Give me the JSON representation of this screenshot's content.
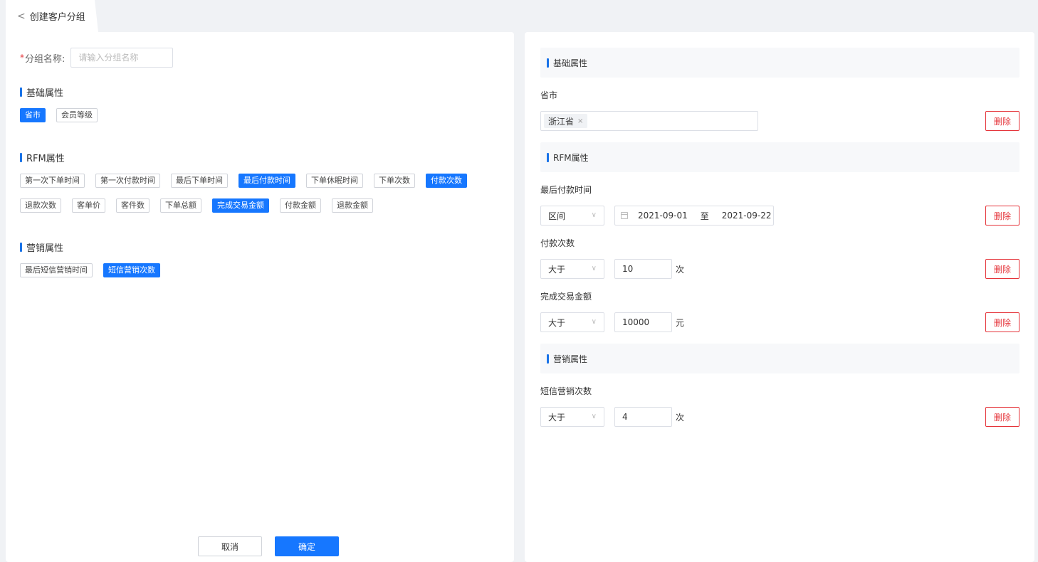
{
  "header": {
    "back_icon": "chevron-left-icon",
    "title": "创建客户分组"
  },
  "form": {
    "required_mark": "*",
    "name_label": "分组名称:",
    "name_placeholder": "请输入分组名称"
  },
  "attribute_groups": [
    {
      "title": "基础属性",
      "tags": [
        {
          "label": "省市",
          "selected": true
        },
        {
          "label": "会员等级",
          "selected": false
        }
      ]
    },
    {
      "title": "RFM属性",
      "tags": [
        {
          "label": "第一次下单时间",
          "selected": false
        },
        {
          "label": "第一次付款时间",
          "selected": false
        },
        {
          "label": "最后下单时间",
          "selected": false
        },
        {
          "label": "最后付款时间",
          "selected": true
        },
        {
          "label": "下单休眠时间",
          "selected": false
        },
        {
          "label": "下单次数",
          "selected": false
        },
        {
          "label": "付款次数",
          "selected": true
        },
        {
          "label": "退款次数",
          "selected": false
        },
        {
          "label": "客单价",
          "selected": false
        },
        {
          "label": "客件数",
          "selected": false
        },
        {
          "label": "下单总额",
          "selected": false
        },
        {
          "label": "完成交易金额",
          "selected": true
        },
        {
          "label": "付款金额",
          "selected": false
        },
        {
          "label": "退款金额",
          "selected": false
        }
      ]
    },
    {
      "title": "营销属性",
      "tags": [
        {
          "label": "最后短信营销时间",
          "selected": false
        },
        {
          "label": "短信营销次数",
          "selected": true
        }
      ]
    }
  ],
  "buttons": {
    "cancel": "取消",
    "confirm": "确定"
  },
  "conditions": {
    "basic": {
      "title": "基础属性",
      "province": {
        "label": "省市",
        "chip": "浙江省",
        "chip_close": "×"
      }
    },
    "rfm": {
      "title": "RFM属性",
      "last_payment_time": {
        "label": "最后付款时间",
        "operator": "区间",
        "start": "2021-09-01",
        "to": "至",
        "end": "2021-09-22"
      },
      "payment_count": {
        "label": "付款次数",
        "operator": "大于",
        "value": "10",
        "unit": "次"
      },
      "completed_amount": {
        "label": "完成交易金额",
        "operator": "大于",
        "value": "10000",
        "unit": "元"
      }
    },
    "marketing": {
      "title": "营销属性",
      "sms_count": {
        "label": "短信营销次数",
        "operator": "大于",
        "value": "4",
        "unit": "次"
      }
    },
    "delete_label": "删除",
    "dropdown_arrow": "∨"
  },
  "colors": {
    "primary": "#1677ff",
    "danger": "#e5343a",
    "section_bar": "#1a73e8"
  }
}
